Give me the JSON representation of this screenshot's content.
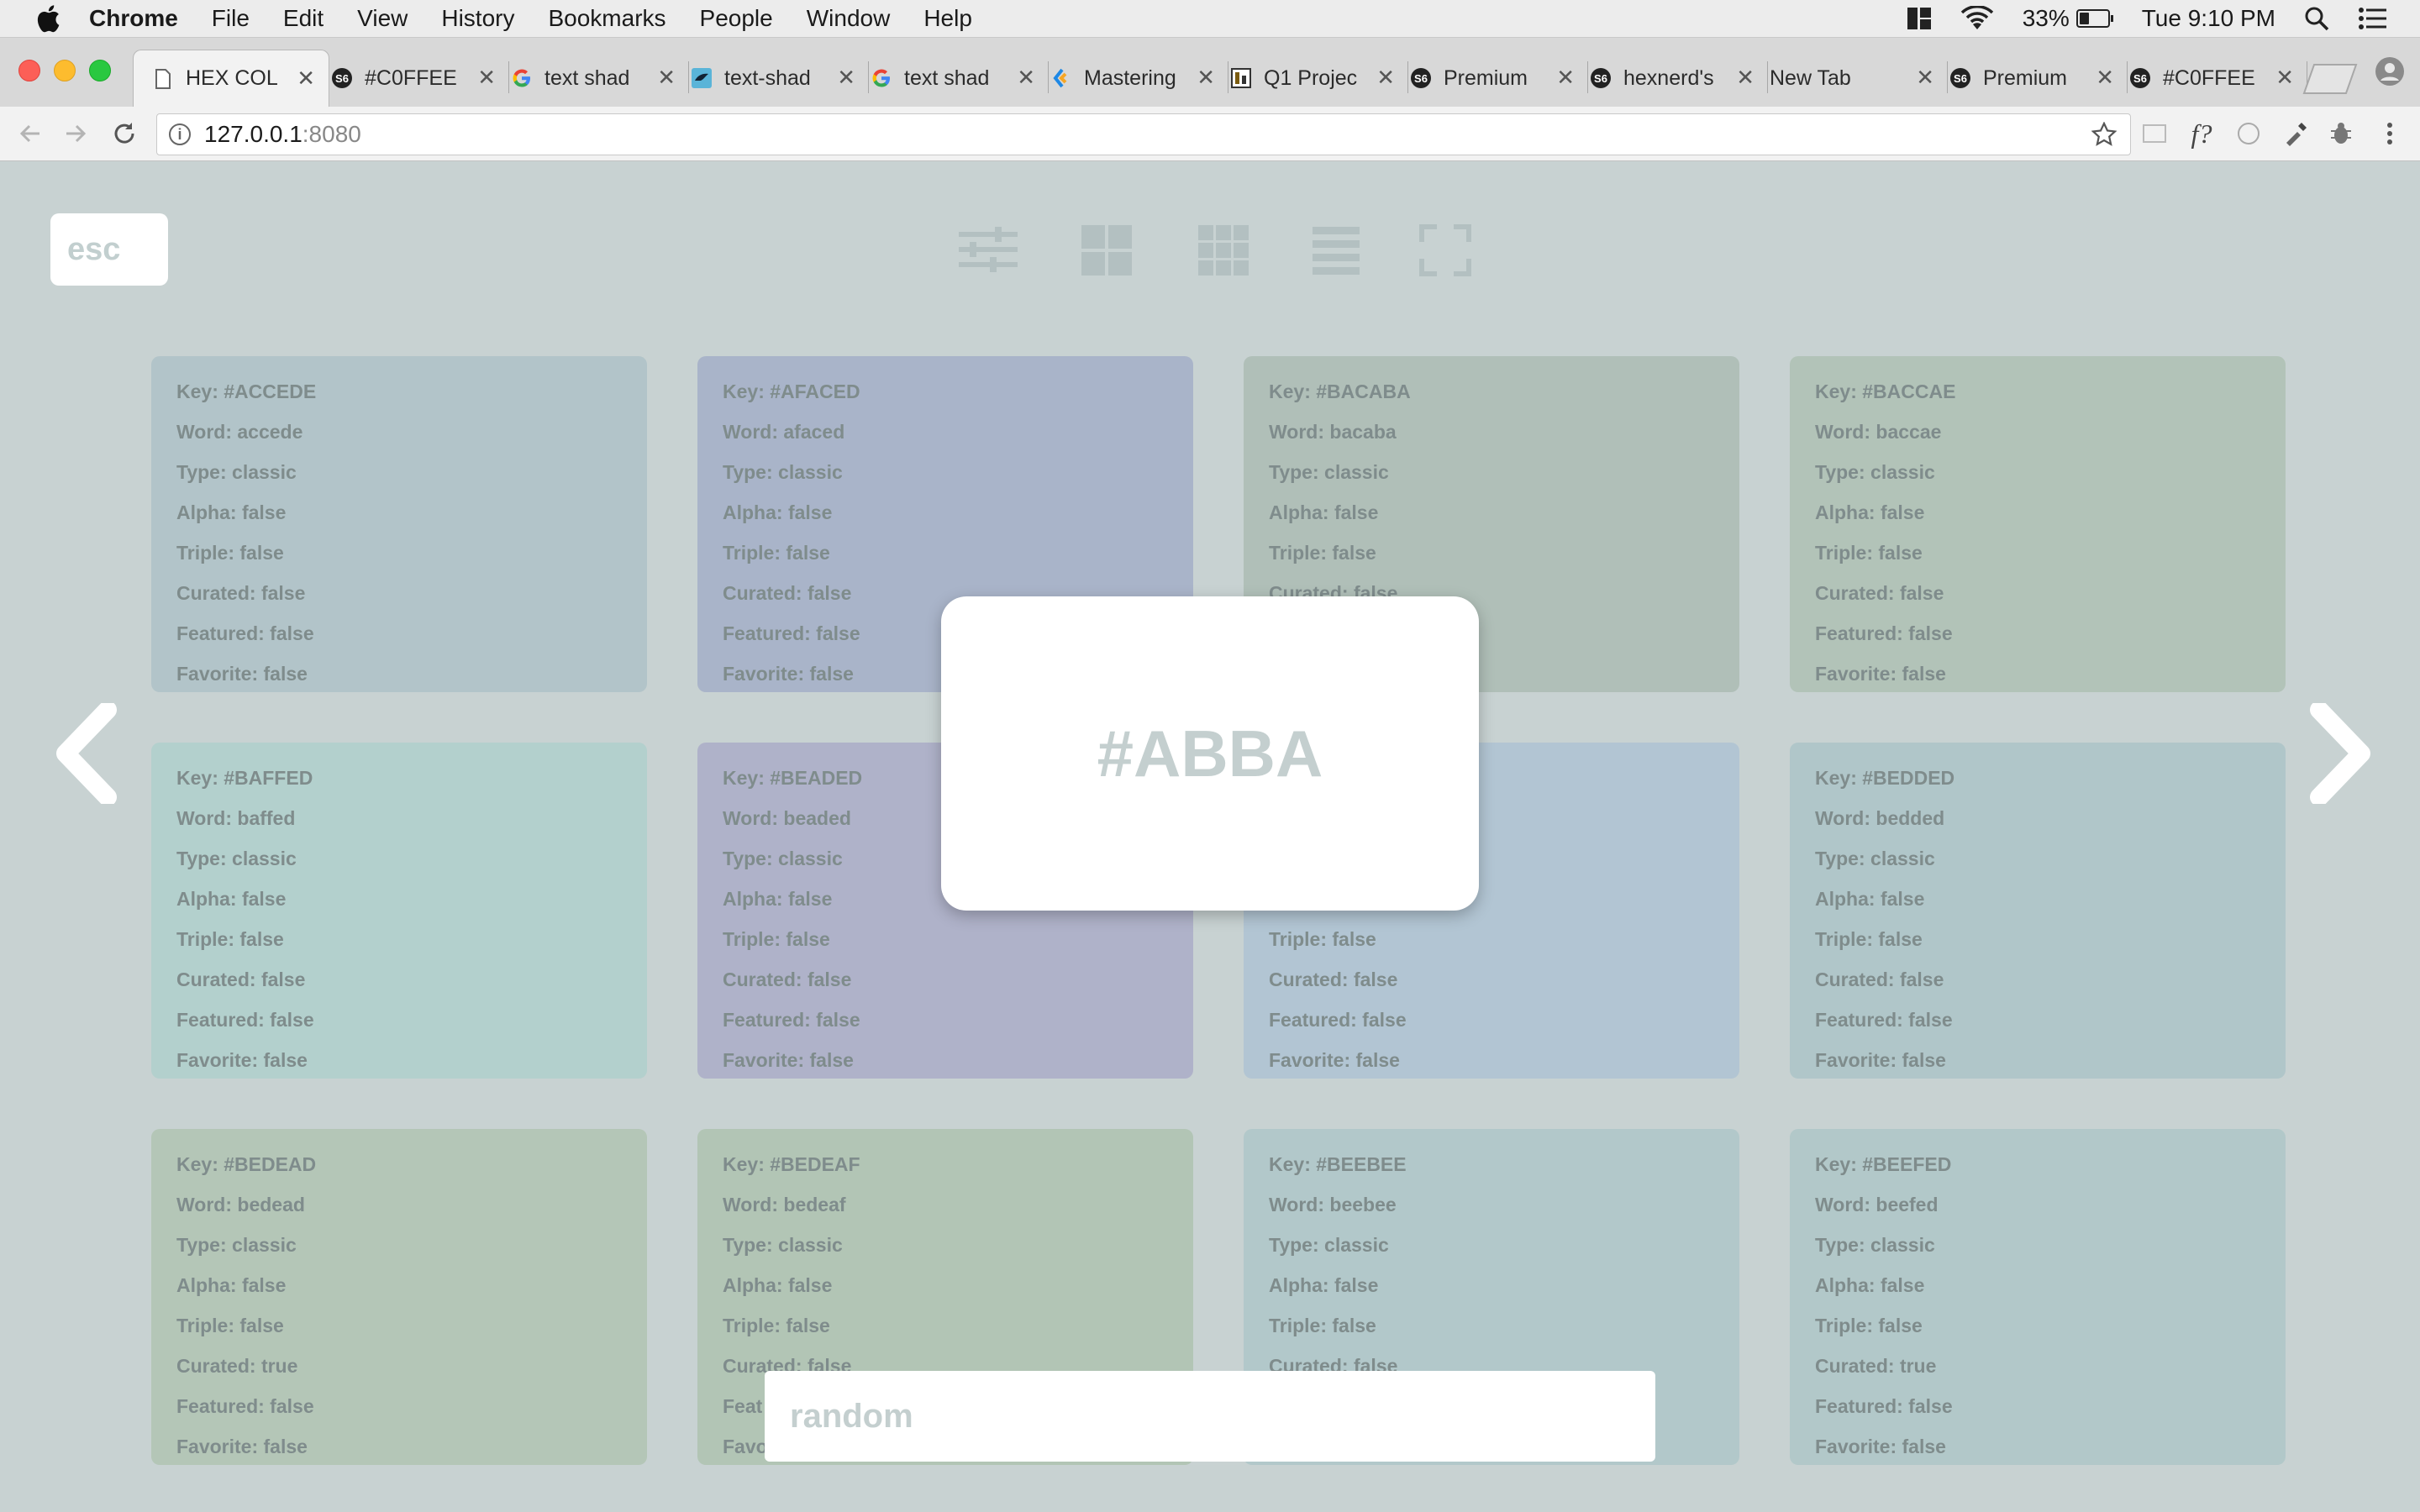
{
  "menubar": {
    "app": "Chrome",
    "items": [
      "File",
      "Edit",
      "View",
      "History",
      "Bookmarks",
      "People",
      "Window",
      "Help"
    ],
    "battery": "33%",
    "time": "Tue 9:10 PM"
  },
  "tabs": [
    {
      "title": "HEX COL",
      "icon": "page-icon"
    },
    {
      "title": "#C0FFEE",
      "icon": "hexnerd-icon"
    },
    {
      "title": "text shad",
      "icon": "google-icon"
    },
    {
      "title": "text-shad",
      "icon": "bird-icon"
    },
    {
      "title": "text shad",
      "icon": "google-icon"
    },
    {
      "title": "Mastering",
      "icon": "arrow-logo-icon"
    },
    {
      "title": "Q1 Projec",
      "icon": "sheet-icon"
    },
    {
      "title": "Premium",
      "icon": "hexnerd-icon"
    },
    {
      "title": "hexnerd's",
      "icon": "hexnerd-icon"
    },
    {
      "title": "New Tab",
      "icon": "none"
    },
    {
      "title": "Premium",
      "icon": "hexnerd-icon"
    },
    {
      "title": "#C0FFEE",
      "icon": "hexnerd-icon"
    }
  ],
  "address": {
    "host": "127.0.0.1",
    "port": ":8080"
  },
  "page": {
    "esc_label": "esc",
    "modal_hex": "#ABBA",
    "random_placeholder": "random"
  },
  "colors": {
    "background": "#c8d2d2",
    "card_colors": [
      "#b2c4c9",
      "#a9b4c9",
      "#b0bfb8",
      "#b2c3b8",
      "#b3d0cd",
      "#afb2c9",
      "#b2c5d3",
      "#b0c6c9",
      "#b4c6b7",
      "#b2c5b5",
      "#b2c8ca",
      "#b2c8c9"
    ]
  },
  "cards": [
    {
      "key": "Key: #ACCEDE",
      "word": "Word: accede",
      "type": "Type: classic",
      "alpha": "Alpha: false",
      "triple": "Triple: false",
      "curated": "Curated: false",
      "featured": "Featured: false",
      "favorite": "Favorite: false"
    },
    {
      "key": "Key: #AFACED",
      "word": "Word: afaced",
      "type": "Type: classic",
      "alpha": "Alpha: false",
      "triple": "Triple: false",
      "curated": "Curated: false",
      "featured": "Featured: false",
      "favorite": "Favorite: false"
    },
    {
      "key": "Key: #BACABA",
      "word": "Word: bacaba",
      "type": "Type: classic",
      "alpha": "Alpha: false",
      "triple": "Triple: false",
      "curated": "Curated: false",
      "featured": "",
      "favorite": ""
    },
    {
      "key": "Key: #BACCAE",
      "word": "Word: baccae",
      "type": "Type: classic",
      "alpha": "Alpha: false",
      "triple": "Triple: false",
      "curated": "Curated: false",
      "featured": "Featured: false",
      "favorite": "Favorite: false"
    },
    {
      "key": "Key: #BAFFED",
      "word": "Word: baffed",
      "type": "Type: classic",
      "alpha": "Alpha: false",
      "triple": "Triple: false",
      "curated": "Curated: false",
      "featured": "Featured: false",
      "favorite": "Favorite: false"
    },
    {
      "key": "Key: #BEADED",
      "word": "Word: beaded",
      "type": "Type: classic",
      "alpha": "Alpha: false",
      "triple": "Triple: false",
      "curated": "Curated: false",
      "featured": "Featured: false",
      "favorite": "Favorite: false"
    },
    {
      "key": "",
      "word": "",
      "type": "",
      "alpha": "",
      "triple": "Triple: false",
      "curated": "Curated: false",
      "featured": "Featured: false",
      "favorite": "Favorite: false"
    },
    {
      "key": "Key: #BEDDED",
      "word": "Word: bedded",
      "type": "Type: classic",
      "alpha": "Alpha: false",
      "triple": "Triple: false",
      "curated": "Curated: false",
      "featured": "Featured: false",
      "favorite": "Favorite: false"
    },
    {
      "key": "Key: #BEDEAD",
      "word": "Word: bedead",
      "type": "Type: classic",
      "alpha": "Alpha: false",
      "triple": "Triple: false",
      "curated": "Curated: true",
      "featured": "Featured: false",
      "favorite": "Favorite: false"
    },
    {
      "key": "Key: #BEDEAF",
      "word": "Word: bedeaf",
      "type": "Type: classic",
      "alpha": "Alpha: false",
      "triple": "Triple: false",
      "curated": "Curated: false",
      "featured": "Feat",
      "favorite": "Favo"
    },
    {
      "key": "Key: #BEEBEE",
      "word": "Word: beebee",
      "type": "Type: classic",
      "alpha": "Alpha: false",
      "triple": "Triple: false",
      "curated": "Curated: false",
      "featured": "",
      "favorite": ""
    },
    {
      "key": "Key: #BEEFED",
      "word": "Word: beefed",
      "type": "Type: classic",
      "alpha": "Alpha: false",
      "triple": "Triple: false",
      "curated": "Curated: true",
      "featured": "Featured: false",
      "favorite": "Favorite: false"
    }
  ]
}
